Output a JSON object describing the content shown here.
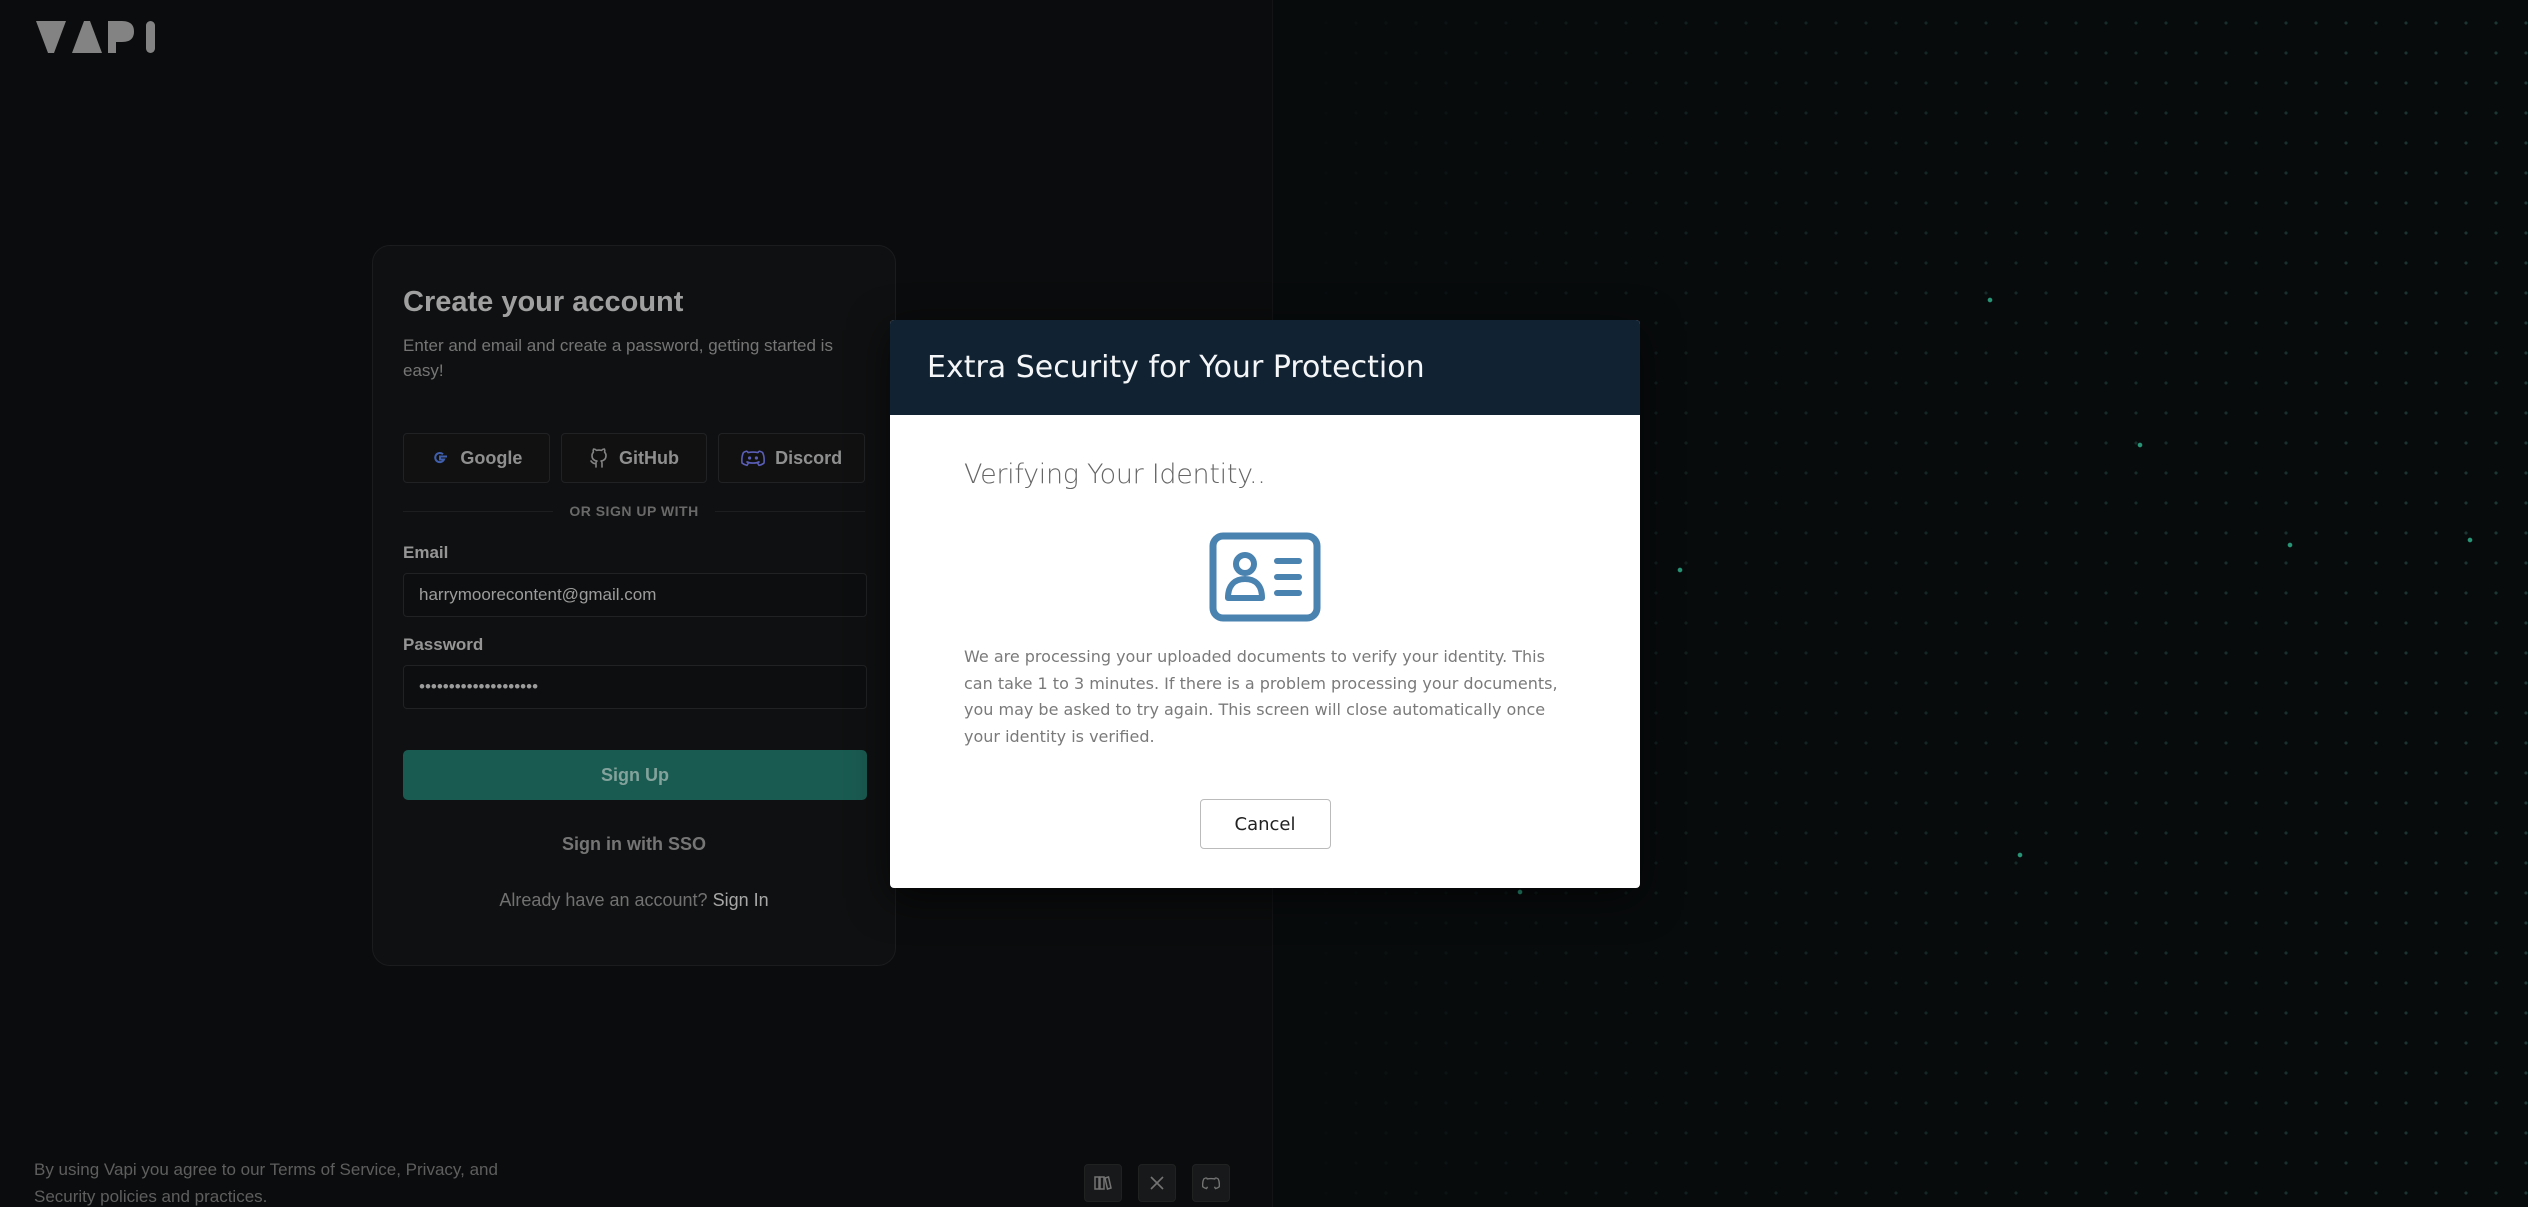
{
  "brand": {
    "logo_text": "VAPI"
  },
  "signup": {
    "title": "Create your account",
    "subtitle": "Enter and email and create a password, getting started is easy!",
    "oauth": [
      {
        "label": "Google",
        "icon": "google-icon"
      },
      {
        "label": "GitHub",
        "icon": "github-icon"
      },
      {
        "label": "Discord",
        "icon": "discord-icon"
      }
    ],
    "divider": "OR SIGN UP WITH",
    "email_label": "Email",
    "email_value": "harrymoorecontent@gmail.com",
    "password_label": "Password",
    "password_value": "••••••••••••••••••••",
    "signup_button": "Sign Up",
    "sso_link": "Sign in with SSO",
    "already_text": "Already have an account?",
    "signin_link": "Sign In"
  },
  "footer": {
    "legal": "By using Vapi you agree to our Terms of Service, Privacy, and Security policies and practices.",
    "social_icons": [
      "docs-icon",
      "x-icon",
      "discord-icon"
    ]
  },
  "modal": {
    "header": "Extra Security for Your Protection",
    "title": "Verifying Your Identity..",
    "icon": "id-card-icon",
    "message": "We are processing your uploaded documents to verify your identity. This can take 1 to 3 minutes. If there is a problem processing your documents, you may be asked to try again. This screen will close automatically once your identity is verified.",
    "cancel_button": "Cancel"
  },
  "colors": {
    "accent": "#1f6b60",
    "modal_header": "#112233",
    "id_icon": "#4a82b0"
  }
}
